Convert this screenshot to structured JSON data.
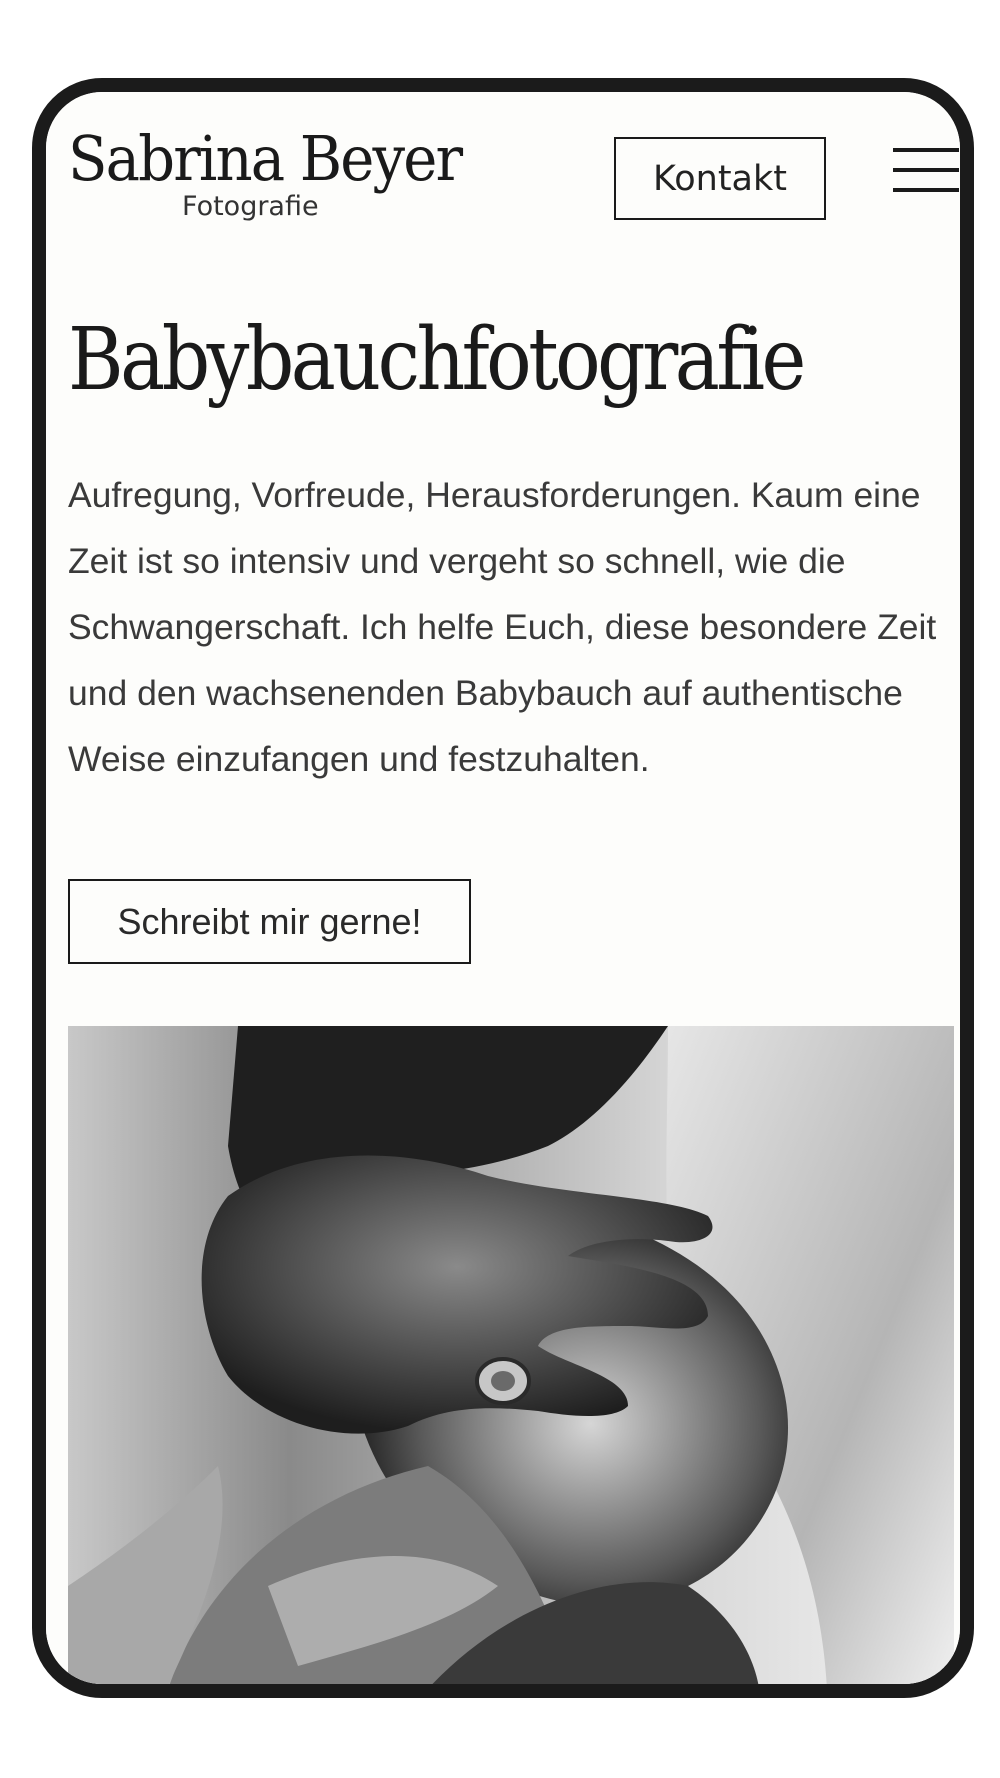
{
  "header": {
    "logo_name": "Sabrina Beyer",
    "logo_subtitle": "Fotografie",
    "contact_label": "Kontakt",
    "menu_icon": "hamburger-menu-icon"
  },
  "hero": {
    "title": "Babybauchfotografie",
    "text": "Aufregung, Vorfreude, Herausforderungen. Kaum eine Zeit ist so intensiv und vergeht so schnell, wie die Schwangerschaft. Ich helfe Euch, diese besondere Zeit und den wachsenenden Babybauch auf authentische Weise einzufangen und festzuhalten.",
    "cta_label": "Schreibt mir gerne!"
  },
  "colors": {
    "background": "#fdfdfb",
    "text": "#1a1a1a",
    "frame": "#1b1b1b"
  }
}
